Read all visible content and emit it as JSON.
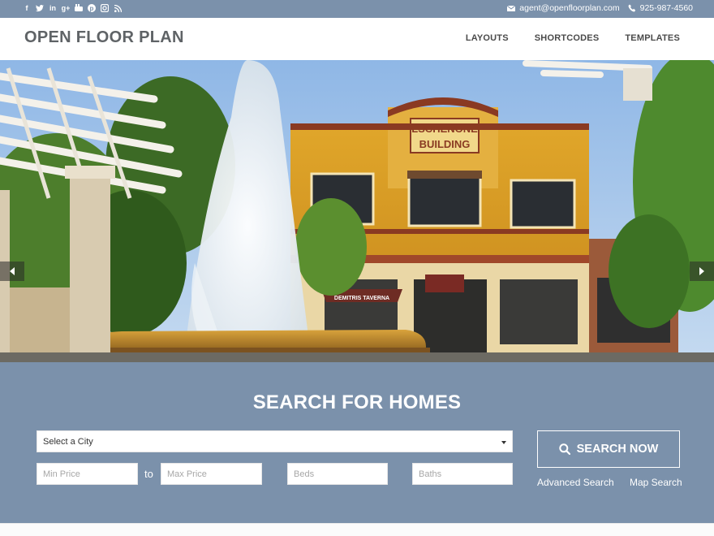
{
  "topbar": {
    "social_icons": [
      "facebook-icon",
      "twitter-icon",
      "linkedin-icon",
      "google-plus-icon",
      "youtube-icon",
      "pinterest-icon",
      "instagram-icon",
      "rss-icon"
    ],
    "email": "agent@openfloorplan.com",
    "phone": "925-987-4560"
  },
  "header": {
    "logo": "OPEN FLOOR PLAN",
    "nav": [
      "LAYOUTS",
      "SHORTCODES",
      "TEMPLATES"
    ]
  },
  "hero": {
    "building_sign_line1": "LSCHENONE",
    "building_sign_line2": "BUILDING",
    "awning_text": "DEMITRIS TAVERNA",
    "arrow_prev": "previous-arrow-icon",
    "arrow_next": "next-arrow-icon"
  },
  "search": {
    "title": "SEARCH FOR HOMES",
    "city_select_value": "Select a City",
    "min_price_placeholder": "Min Price",
    "to_label": "to",
    "max_price_placeholder": "Max Price",
    "beds_placeholder": "Beds",
    "baths_placeholder": "Baths",
    "button_label": "SEARCH NOW",
    "advanced_link": "Advanced Search",
    "map_link": "Map Search"
  },
  "colors": {
    "brand_slate": "#7b91ab",
    "header_text": "#5f6366",
    "white": "#ffffff"
  }
}
